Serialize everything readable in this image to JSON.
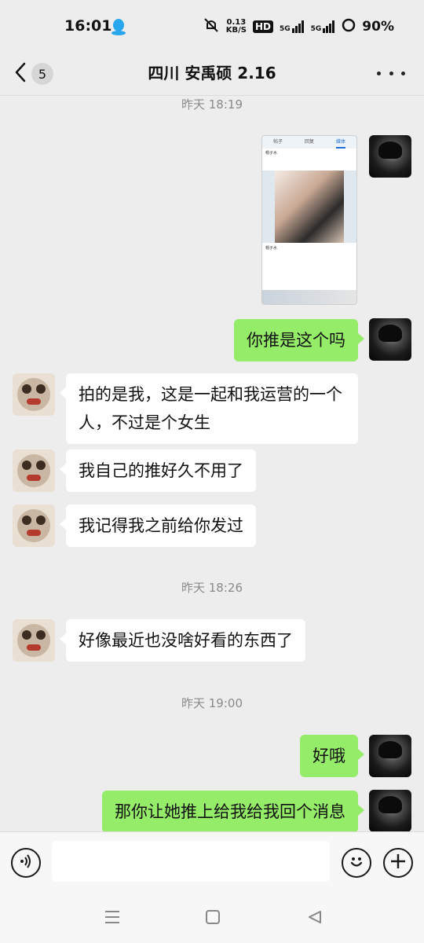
{
  "status_bar": {
    "time": "16:01",
    "network_speed_value": "0.13",
    "network_speed_unit": "KB/S",
    "hd_label": "HD",
    "signal1_label": "5G",
    "signal2_label": "5G",
    "battery": "90%"
  },
  "nav": {
    "unread_count": "5",
    "title": "四川 安禹硕 2.16"
  },
  "messages": {
    "ts1": "昨天 18:19",
    "m2": "你推是这个吗",
    "m3": "拍的是我，这是一起和我运营的一个人，不过是个女生",
    "m4": "我自己的推好久不用了",
    "m5": "我记得我之前给你发过",
    "ts2": "昨天 18:26",
    "m6": "好像最近也没啥好看的东西了",
    "ts3": "昨天 19:00",
    "m7": "好哦",
    "m8": "那你让她推上给我给我回个消息"
  },
  "image_message": {
    "tab1": "帖子",
    "tab2": "回复",
    "tab3": "媒体",
    "post_author": "帽子水",
    "post2_author": "帽子水"
  },
  "input": {
    "value": ""
  },
  "colors": {
    "background": "#ededed",
    "my_bubble": "#95ec69",
    "their_bubble": "#ffffff"
  },
  "icons": [
    "qq-icon",
    "mute-icon",
    "back-icon",
    "more-icon",
    "voice-icon",
    "emoji-icon",
    "add-icon",
    "menu-icon",
    "home-icon",
    "back-triangle-icon"
  ]
}
